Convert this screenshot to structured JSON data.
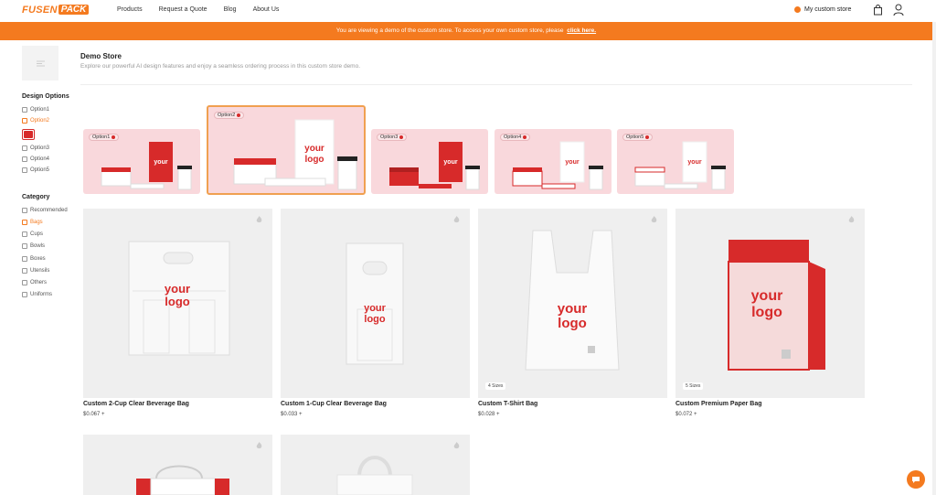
{
  "header": {
    "logo_part1": "FUSEN",
    "logo_part2": "PACK",
    "nav": [
      "Products",
      "Request a Quote",
      "Blog",
      "About Us"
    ],
    "custom_store": "My custom store"
  },
  "banner": {
    "text": "You are viewing a demo of the custom store. To access your own custom store, please",
    "link": "click here."
  },
  "store": {
    "title": "Demo Store",
    "description": "Explore our powerful AI design features and enjoy a seamless ordering process in this custom store demo."
  },
  "design_options": {
    "heading": "Design Options",
    "items": [
      "Option1",
      "Option2",
      "Option3",
      "Option4",
      "Option5"
    ],
    "selected": "Option2",
    "swatch_color": "#d72a2a"
  },
  "category": {
    "heading": "Category",
    "items": [
      "Recommended",
      "Bags",
      "Cups",
      "Bowls",
      "Boxes",
      "Utensils",
      "Others",
      "Uniforms"
    ],
    "selected": "Bags"
  },
  "option_cards": [
    {
      "label": "Option1"
    },
    {
      "label": "Option2"
    },
    {
      "label": "Option3"
    },
    {
      "label": "Option4"
    },
    {
      "label": "Option5"
    }
  ],
  "products": [
    {
      "name": "Custom 2-Cup Clear Beverage Bag",
      "price": "$0.067 +",
      "badge": ""
    },
    {
      "name": "Custom 1-Cup Clear Beverage Bag",
      "price": "$0.033 +",
      "badge": ""
    },
    {
      "name": "Custom T-Shirt Bag",
      "price": "$0.028 +",
      "badge": "4 Sizes"
    },
    {
      "name": "Custom Premium Paper Bag",
      "price": "$0.072 +",
      "badge": "5 Sizes"
    }
  ],
  "logo_print": [
    "your",
    "logo"
  ],
  "colors": {
    "accent": "#f47a1f",
    "brand_red": "#d72a2a",
    "option_bg": "#f9d8dc"
  }
}
